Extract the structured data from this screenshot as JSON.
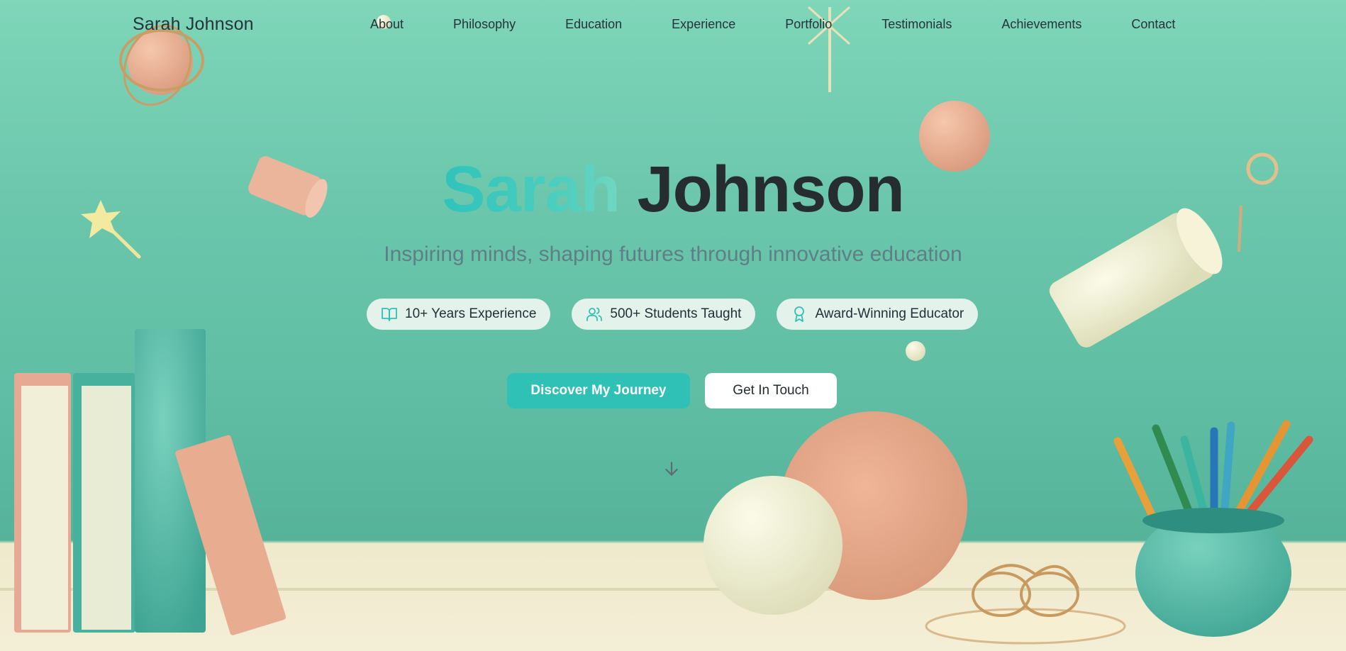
{
  "nav": {
    "logo": "Sarah Johnson",
    "links": [
      "About",
      "Philosophy",
      "Education",
      "Experience",
      "Portfolio",
      "Testimonials",
      "Achievements",
      "Contact"
    ]
  },
  "hero": {
    "first_name": "Sarah",
    "last_name": "Johnson",
    "subtitle": "Inspiring minds, shaping futures through innovative education",
    "badges": [
      {
        "icon": "open-book-icon",
        "label": "10+ Years Experience"
      },
      {
        "icon": "users-icon",
        "label": "500+ Students Taught"
      },
      {
        "icon": "award-icon",
        "label": "Award-Winning Educator"
      }
    ],
    "primary_cta": "Discover My Journey",
    "secondary_cta": "Get In Touch",
    "scroll_icon": "arrow-down-icon"
  },
  "colors": {
    "accent": "#2fc0b6",
    "text_dark": "#262d31",
    "subtitle": "#5f7f86",
    "background": "#6cc7ac"
  }
}
